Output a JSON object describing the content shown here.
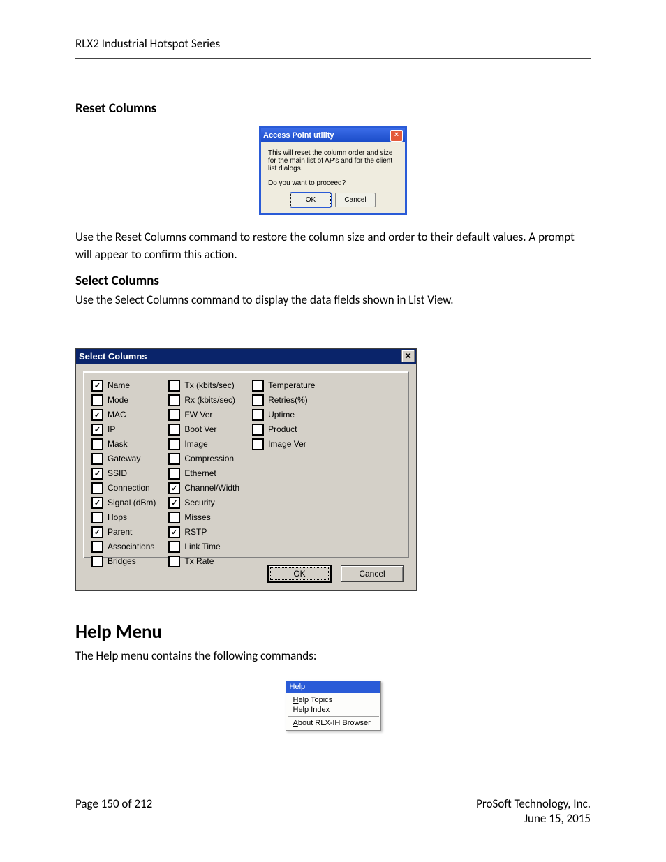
{
  "header": {
    "title": "RLX2 Industrial Hotspot Series"
  },
  "section_reset": {
    "heading": "Reset Columns",
    "desc": "Use the Reset Columns command to restore the column size and order to their default values. A prompt will appear to confirm this action."
  },
  "dlg1": {
    "title": "Access Point utility",
    "line1": "This will reset the column order and size for the main list of AP's and for the client list dialogs.",
    "line2": "Do you want to proceed?",
    "ok": "OK",
    "cancel": "Cancel"
  },
  "section_select": {
    "heading": "Select Columns",
    "desc": "Use the Select Columns command to display the data fields shown in List View."
  },
  "dlg2": {
    "title": "Select Columns",
    "ok": "OK",
    "cancel": "Cancel",
    "col1": [
      {
        "label": "Name",
        "checked": true
      },
      {
        "label": "Mode",
        "checked": false
      },
      {
        "label": "MAC",
        "checked": true
      },
      {
        "label": "IP",
        "checked": true
      },
      {
        "label": "Mask",
        "checked": false
      },
      {
        "label": "Gateway",
        "checked": false
      },
      {
        "label": "SSID",
        "checked": true
      },
      {
        "label": "Connection",
        "checked": false
      },
      {
        "label": "Signal (dBm)",
        "checked": true
      },
      {
        "label": "Hops",
        "checked": false
      },
      {
        "label": "Parent",
        "checked": true
      },
      {
        "label": "Associations",
        "checked": false
      },
      {
        "label": "Bridges",
        "checked": false
      }
    ],
    "col2": [
      {
        "label": "Tx (kbits/sec)",
        "checked": false
      },
      {
        "label": "Rx (kbits/sec)",
        "checked": false
      },
      {
        "label": "FW Ver",
        "checked": false
      },
      {
        "label": "Boot Ver",
        "checked": false
      },
      {
        "label": "Image",
        "checked": false
      },
      {
        "label": "Compression",
        "checked": false
      },
      {
        "label": "Ethernet",
        "checked": false
      },
      {
        "label": "Channel/Width",
        "checked": true
      },
      {
        "label": "Security",
        "checked": true
      },
      {
        "label": "Misses",
        "checked": false
      },
      {
        "label": "RSTP",
        "checked": true
      },
      {
        "label": "Link Time",
        "checked": false
      },
      {
        "label": "Tx Rate",
        "checked": false
      }
    ],
    "col3": [
      {
        "label": "Temperature",
        "checked": false
      },
      {
        "label": "Retries(%)",
        "checked": false
      },
      {
        "label": "Uptime",
        "checked": false
      },
      {
        "label": "Product",
        "checked": false
      },
      {
        "label": "Image Ver",
        "checked": false
      }
    ]
  },
  "section_help": {
    "heading": "Help Menu",
    "desc": "The Help menu contains the following commands:"
  },
  "helpmenu": {
    "title_pre": "H",
    "title_rest": "elp",
    "item1_u": "H",
    "item1_rest": "elp Topics",
    "item2": "Help Index",
    "item3_u": "A",
    "item3_rest": "bout RLX-IH Browser"
  },
  "footer": {
    "page": "Page 150 of 212",
    "company": "ProSoft Technology, Inc.",
    "date": "June 15, 2015"
  }
}
